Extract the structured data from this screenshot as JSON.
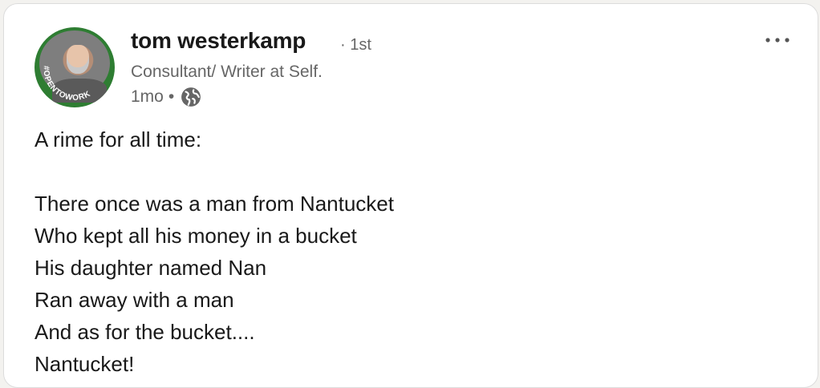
{
  "post": {
    "author": {
      "name": "tom westerkamp",
      "connection_degree": "1st",
      "headline": "Consultant/ Writer at Self.",
      "avatar_badge_text": "#OPENTOWORK",
      "badge_color": "#2e7d32"
    },
    "timestamp": "1mo",
    "separator": "•",
    "visibility_icon": "globe-icon",
    "menu_icon": "more-horizontal-icon",
    "body_lines": [
      "A rime for all time:",
      "",
      "There once was a man from Nantucket",
      "Who kept all his money in a bucket",
      "His daughter named Nan",
      "Ran away with a man",
      "And as for the bucket....",
      "Nantucket!"
    ]
  }
}
